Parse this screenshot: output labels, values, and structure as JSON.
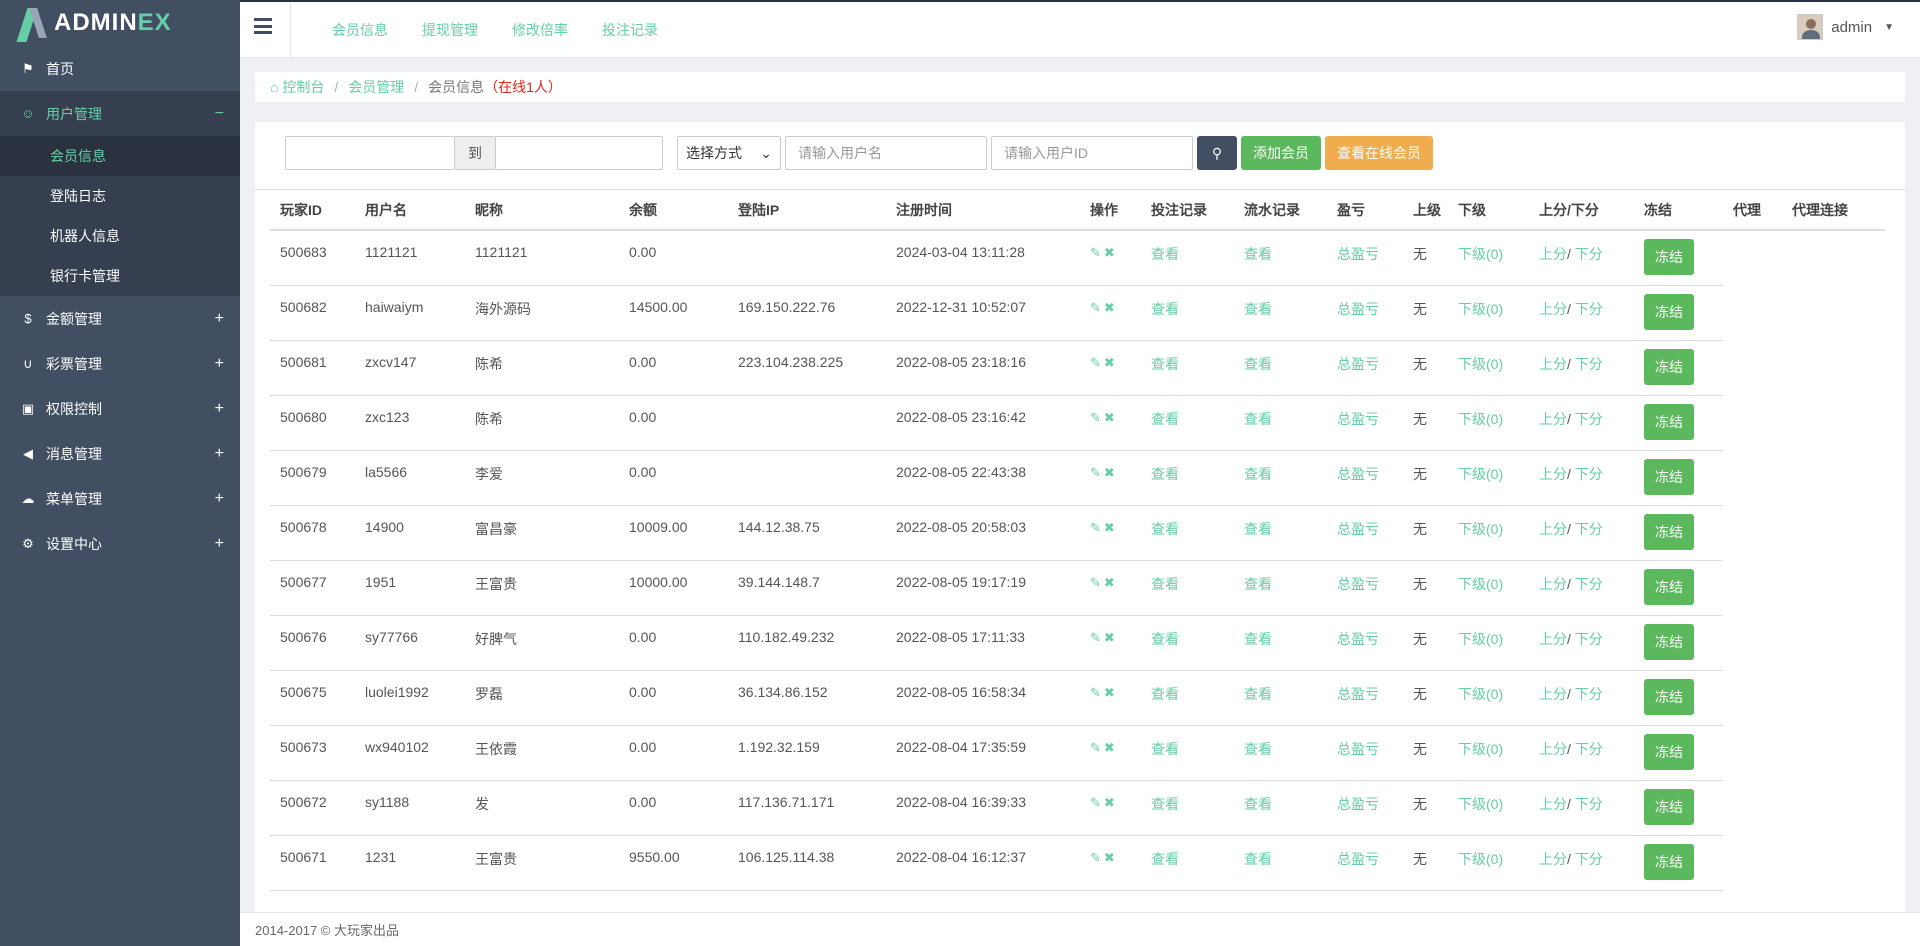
{
  "brand": {
    "name_a": "ADMIN",
    "name_b": "EX"
  },
  "sidebar": {
    "items": [
      {
        "label": "首页",
        "icon": "flag-icon",
        "glyph": "⚑",
        "toggle": ""
      },
      {
        "label": "用户管理",
        "icon": "smile-icon",
        "glyph": "☺",
        "toggle": "−"
      },
      {
        "label": "金额管理",
        "icon": "dollar-icon",
        "glyph": "$",
        "toggle": "+"
      },
      {
        "label": "彩票管理",
        "icon": "magnet-icon",
        "glyph": "∪",
        "toggle": "+"
      },
      {
        "label": "权限控制",
        "icon": "lock-icon",
        "glyph": "▣",
        "toggle": "+"
      },
      {
        "label": "消息管理",
        "icon": "bullhorn-icon",
        "glyph": "◀",
        "toggle": "+"
      },
      {
        "label": "菜单管理",
        "icon": "cloud-icon",
        "glyph": "☁",
        "toggle": "+"
      },
      {
        "label": "设置中心",
        "icon": "gear-icon",
        "glyph": "⚙",
        "toggle": "+"
      }
    ],
    "sub_items": [
      {
        "label": "会员信息"
      },
      {
        "label": "登陆日志"
      },
      {
        "label": "机器人信息"
      },
      {
        "label": "银行卡管理"
      }
    ]
  },
  "header": {
    "nav": [
      "会员信息",
      "提现管理",
      "修改倍率",
      "投注记录"
    ],
    "user": "admin"
  },
  "breadcrumb": {
    "home": "控制台",
    "level2": "会员管理",
    "current": "会员信息",
    "online": "（在线1人）"
  },
  "toolbar": {
    "date_to": "到",
    "method_select": "选择方式",
    "username_placeholder": "请输入用户名",
    "userid_placeholder": "请输入用户ID",
    "add_member": "添加会员",
    "view_online": "查看在线会员"
  },
  "table": {
    "headers": [
      "玩家ID",
      "用户名",
      "昵称",
      "余额",
      "登陆IP",
      "注册时间",
      "操作",
      "投注记录",
      "流水记录",
      "盈亏",
      "上级",
      "下级",
      "上分/下分",
      "冻结",
      "代理",
      "代理连接"
    ],
    "view_label": "查看",
    "pl_label": "总盈亏",
    "up_label": "上分",
    "down_label": "下分",
    "freeze_label": "冻结",
    "rows": [
      {
        "id": "500683",
        "username": "1121121",
        "nickname": "1121121",
        "balance": "0.00",
        "ip": "",
        "reg_time": "2024-03-04 13:11:28",
        "parent": "无",
        "children": "下级(0)"
      },
      {
        "id": "500682",
        "username": "haiwaiym",
        "nickname": "海外源码",
        "balance": "14500.00",
        "ip": "169.150.222.76",
        "reg_time": "2022-12-31 10:52:07",
        "parent": "无",
        "children": "下级(0)"
      },
      {
        "id": "500681",
        "username": "zxcv147",
        "nickname": "陈希",
        "balance": "0.00",
        "ip": "223.104.238.225",
        "reg_time": "2022-08-05 23:18:16",
        "parent": "无",
        "children": "下级(0)"
      },
      {
        "id": "500680",
        "username": "zxc123",
        "nickname": "陈希",
        "balance": "0.00",
        "ip": "",
        "reg_time": "2022-08-05 23:16:42",
        "parent": "无",
        "children": "下级(0)"
      },
      {
        "id": "500679",
        "username": "la5566",
        "nickname": "李爱",
        "balance": "0.00",
        "ip": "",
        "reg_time": "2022-08-05 22:43:38",
        "parent": "无",
        "children": "下级(0)"
      },
      {
        "id": "500678",
        "username": "14900",
        "nickname": "富昌豪",
        "balance": "10009.00",
        "ip": "144.12.38.75",
        "reg_time": "2022-08-05 20:58:03",
        "parent": "无",
        "children": "下级(0)"
      },
      {
        "id": "500677",
        "username": "1951",
        "nickname": "王富贵",
        "balance": "10000.00",
        "ip": "39.144.148.7",
        "reg_time": "2022-08-05 19:17:19",
        "parent": "无",
        "children": "下级(0)"
      },
      {
        "id": "500676",
        "username": "sy77766",
        "nickname": "好脾气",
        "balance": "0.00",
        "ip": "110.182.49.232",
        "reg_time": "2022-08-05 17:11:33",
        "parent": "无",
        "children": "下级(0)"
      },
      {
        "id": "500675",
        "username": "luolei1992",
        "nickname": "罗磊",
        "balance": "0.00",
        "ip": "36.134.86.152",
        "reg_time": "2022-08-05 16:58:34",
        "parent": "无",
        "children": "下级(0)"
      },
      {
        "id": "500673",
        "username": "wx940102",
        "nickname": "王依霞",
        "balance": "0.00",
        "ip": "1.192.32.159",
        "reg_time": "2022-08-04 17:35:59",
        "parent": "无",
        "children": "下级(0)"
      },
      {
        "id": "500672",
        "username": "sy1188",
        "nickname": "发",
        "balance": "0.00",
        "ip": "117.136.71.171",
        "reg_time": "2022-08-04 16:39:33",
        "parent": "无",
        "children": "下级(0)"
      },
      {
        "id": "500671",
        "username": "1231",
        "nickname": "王富贵",
        "balance": "9550.00",
        "ip": "106.125.114.38",
        "reg_time": "2022-08-04 16:12:37",
        "parent": "无",
        "children": "下级(0)"
      }
    ]
  },
  "footer": {
    "text": "2014-2017 © 大玩家出品"
  },
  "colors": {
    "accent": "#65cea7",
    "sidebar": "#424f63",
    "success": "#5cb85c",
    "warning": "#f0ad4e",
    "danger": "#e0261c"
  }
}
